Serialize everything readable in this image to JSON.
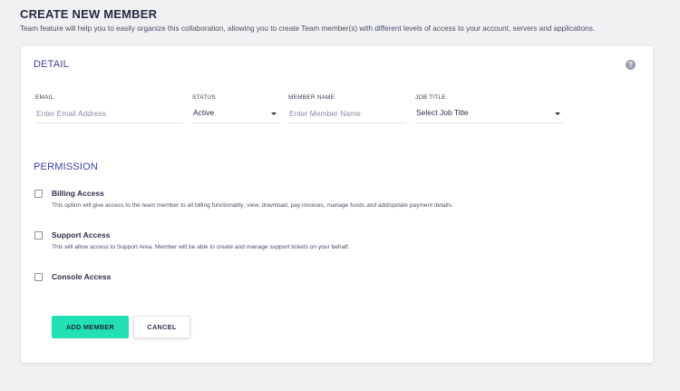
{
  "page": {
    "title": "CREATE NEW MEMBER",
    "subtitle": "Team feature will help you to easily organize this collaboration, allowing you to create Team member(s) with different levels of access to your account, servers and applications."
  },
  "detail": {
    "title": "DETAIL",
    "help_icon": "help-icon",
    "fields": {
      "email": {
        "label": "EMAIL",
        "placeholder": "Enter Email Address",
        "value": ""
      },
      "status": {
        "label": "STATUS",
        "value": "Active"
      },
      "member_name": {
        "label": "MEMBER NAME",
        "placeholder": "Enter Member Name",
        "value": ""
      },
      "job_title": {
        "label": "JOB TITLE",
        "value": "Select Job Title"
      }
    }
  },
  "permission": {
    "title": "PERMISSION",
    "items": [
      {
        "title": "Billing Access",
        "description": "This option will give access to the team member to all billing functionality; view, download, pay invoices, manage funds and add/update payment details.",
        "checked": false
      },
      {
        "title": "Support Access",
        "description": "This will allow access to Support Area. Member will be able to create and manage support tickets on your behalf.",
        "checked": false
      },
      {
        "title": "Console Access",
        "description": "",
        "checked": false
      }
    ]
  },
  "actions": {
    "add_member": "ADD MEMBER",
    "cancel": "CANCEL"
  },
  "colors": {
    "accent": "#22e0b2",
    "section_title": "#3b3fa0",
    "background": "#f1f1f3"
  }
}
